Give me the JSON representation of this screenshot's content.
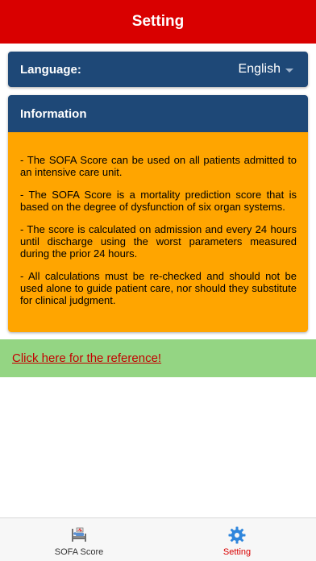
{
  "header": {
    "title": "Setting"
  },
  "language": {
    "label": "Language:",
    "value": "English"
  },
  "information": {
    "title": "Information",
    "paragraphs": [
      "- The SOFA Score can be used on all patients admitted to an intensive care unit.",
      "- The SOFA Score is a mortality prediction score that is based on the degree of dysfunction of six organ systems.",
      "- The score is calculated on admission and every 24 hours until discharge using the worst parameters measured during the prior 24 hours.",
      "- All calculations must be re-checked and should not be used alone to guide patient care, nor should they substitute for clinical judgment."
    ]
  },
  "reference": {
    "link_text": "Click here for the reference!"
  },
  "tabbar": {
    "tabs": [
      {
        "label": "SOFA Score",
        "icon": "hospital-bed-icon",
        "active": false
      },
      {
        "label": "Setting",
        "icon": "gear-icon",
        "active": true
      }
    ]
  },
  "colors": {
    "header": "#d90000",
    "card_header": "#1e4877",
    "info_body": "#ffa500",
    "reference_bar": "#94d583",
    "link": "#c40000",
    "active_tab": "#d90000"
  }
}
